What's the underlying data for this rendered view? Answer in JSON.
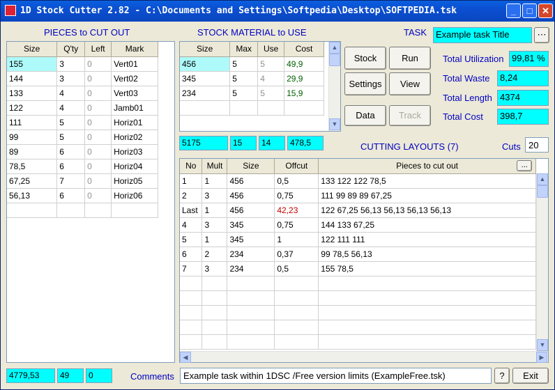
{
  "window": {
    "title": "1D Stock Cutter 2.82  -  C:\\Documents and Settings\\Softpedia\\Desktop\\SOFTPEDIA.tsk"
  },
  "pieces": {
    "heading": "PIECES to CUT OUT",
    "columns": [
      "Size",
      "Q'ty",
      "Left",
      "Mark"
    ],
    "rows": [
      [
        "155",
        "3",
        "0",
        "Vert01"
      ],
      [
        "144",
        "3",
        "0",
        "Vert02"
      ],
      [
        "133",
        "4",
        "0",
        "Vert03"
      ],
      [
        "122",
        "4",
        "0",
        "Jamb01"
      ],
      [
        "111",
        "5",
        "0",
        "Horiz01"
      ],
      [
        "99",
        "5",
        "0",
        "Horiz02"
      ],
      [
        "89",
        "6",
        "0",
        "Horiz03"
      ],
      [
        "78,5",
        "6",
        "0",
        "Horiz04"
      ],
      [
        "67,25",
        "7",
        "0",
        "Horiz05"
      ],
      [
        "56,13",
        "6",
        "0",
        "Horiz06"
      ]
    ],
    "totals": [
      "4779,53",
      "49",
      "0"
    ]
  },
  "stock": {
    "heading": "STOCK MATERIAL to USE",
    "columns": [
      "Size",
      "Max",
      "Use",
      "Cost"
    ],
    "rows": [
      [
        "456",
        "5",
        "5",
        "49,9"
      ],
      [
        "345",
        "5",
        "4",
        "29,9"
      ],
      [
        "234",
        "5",
        "5",
        "15,9"
      ]
    ],
    "totals": [
      "5175",
      "15",
      "14",
      "478,5"
    ]
  },
  "buttons": {
    "stock": "Stock",
    "run": "Run",
    "settings": "Settings",
    "view": "View",
    "data": "Data",
    "track": "Track",
    "ellipsis": "...",
    "help": "?",
    "exit": "Exit"
  },
  "task": {
    "label": "TASK",
    "title": "Example task Title"
  },
  "totals": {
    "utilization_label": "Total Utilization",
    "utilization": "99,81 %",
    "waste_label": "Total Waste",
    "waste": "8,24",
    "length_label": "Total Length",
    "length": "4374",
    "cost_label": "Total Cost",
    "cost": "398,7"
  },
  "layouts": {
    "heading": "CUTTING LAYOUTS (7)",
    "cuts_label": "Cuts",
    "cuts": "20",
    "columns": [
      "No",
      "Mult",
      "Size",
      "Offcut",
      "Pieces to cut out"
    ],
    "rows": [
      [
        "1",
        "1",
        "456",
        "0,5",
        "133  122  122  78,5"
      ],
      [
        "2",
        "3",
        "456",
        "0,75",
        "111  99  89  89  67,25"
      ],
      [
        "Last",
        "1",
        "456",
        "42,23",
        "122  67,25  56,13  56,13  56,13  56,13"
      ],
      [
        "4",
        "3",
        "345",
        "0,75",
        "144  133  67,25"
      ],
      [
        "5",
        "1",
        "345",
        "1",
        "122  111  111"
      ],
      [
        "6",
        "2",
        "234",
        "0,37",
        "99  78,5  56,13"
      ],
      [
        "7",
        "3",
        "234",
        "0,5",
        "155  78,5"
      ]
    ]
  },
  "comments": {
    "label": "Comments",
    "value": "Example task within 1DSC /Free version limits (ExampleFree.tsk)"
  },
  "colors": {
    "accent_cyan": "#00ffff",
    "label_blue": "#0000c0",
    "titlebar": "#0a5fe0"
  }
}
